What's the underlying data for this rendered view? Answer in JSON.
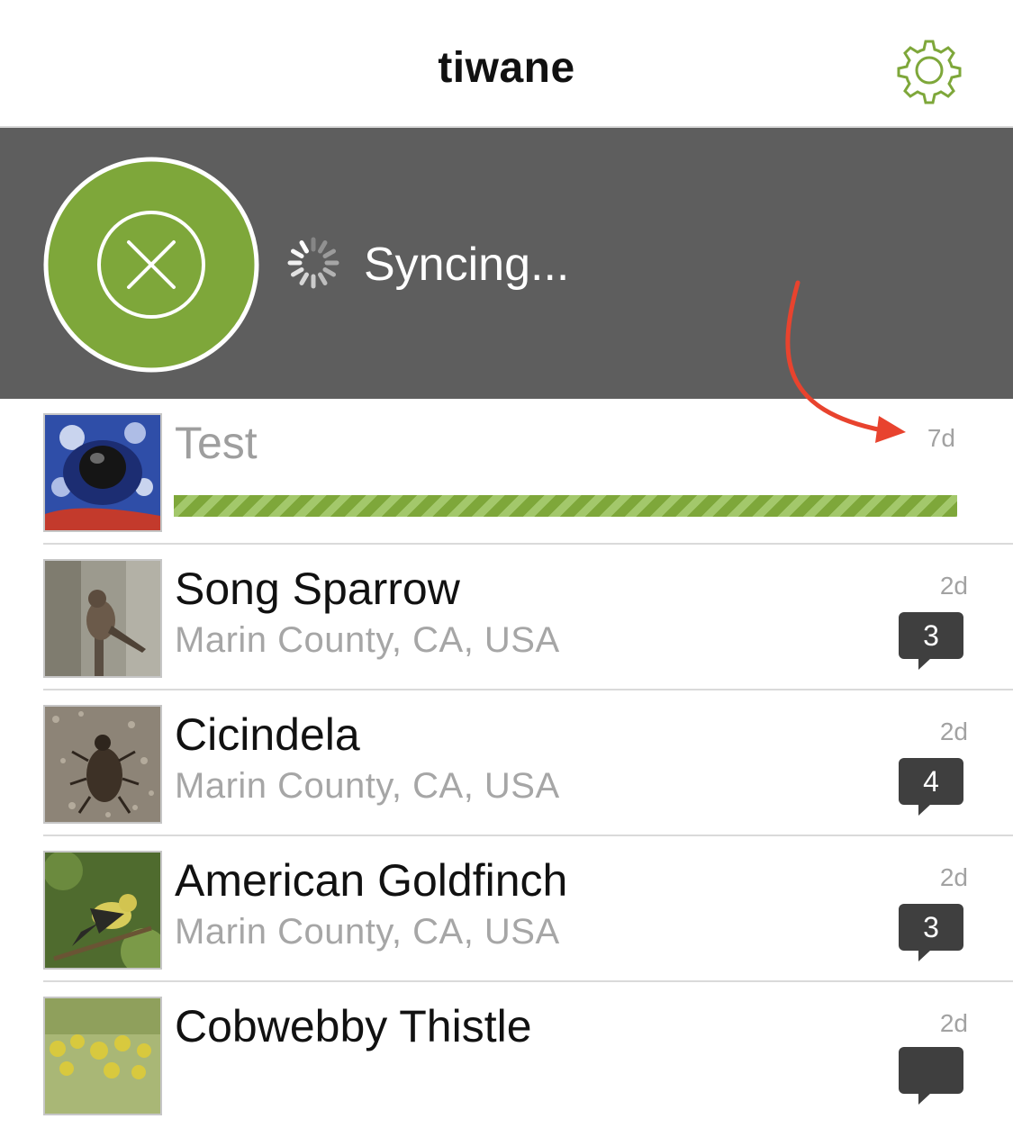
{
  "header": {
    "title": "tiwane",
    "settings_icon": "gear-icon",
    "accent_color": "#7ea73a"
  },
  "sync": {
    "status_text": "Syncing...",
    "cancel_icon": "close-icon",
    "spinner_icon": "spinner-icon",
    "banner_color": "#5e5e5e",
    "button_color": "#7ea73a"
  },
  "annotation": {
    "arrow_color": "#e8432e"
  },
  "observations": [
    {
      "name": "Test",
      "place": "",
      "date": "7d",
      "comments": "",
      "uploading": true,
      "upload_progress": 1.0
    },
    {
      "name": "Song Sparrow",
      "place": "Marin County, CA, USA",
      "date": "2d",
      "comments": "3"
    },
    {
      "name": "Cicindela",
      "place": "Marin County, CA, USA",
      "date": "2d",
      "comments": "4"
    },
    {
      "name": "American Goldfinch",
      "place": "Marin County, CA, USA",
      "date": "2d",
      "comments": "3"
    },
    {
      "name": "Cobwebby Thistle",
      "place": "",
      "date": "2d",
      "comments": ""
    }
  ]
}
